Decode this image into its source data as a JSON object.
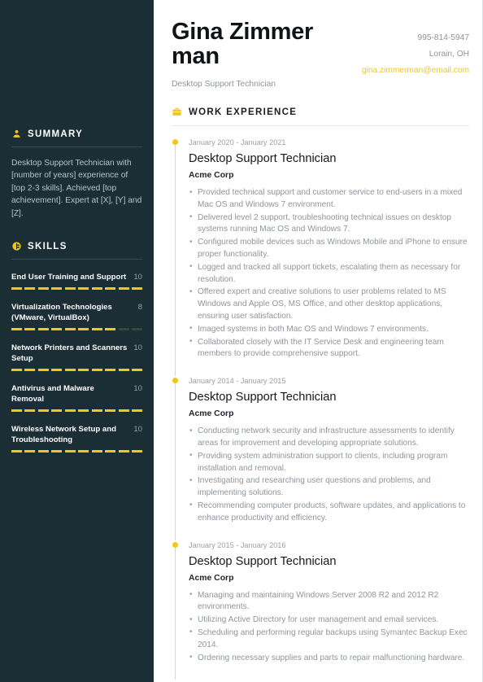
{
  "theme": {
    "sidebar_bg": "#1b2d35",
    "accent": "#f2c71b",
    "page_bg": "#ffffff",
    "muted_text": "#8e959a"
  },
  "sidebar": {
    "summary": {
      "icon": "person-icon",
      "heading": "SUMMARY",
      "text": "Desktop Support Technician with [number of years] experience of [top 2-3 skills]. Achieved [top achievement]. Expert at [X], [Y] and [Z]."
    },
    "skills": {
      "icon": "skill-badge-icon",
      "heading": "SKILLS",
      "max": 10,
      "items": [
        {
          "name": "End User Training and Support",
          "score": "10",
          "value": 10
        },
        {
          "name": "Virtualization Technologies (VMware, VirtualBox)",
          "score": "8",
          "value": 8
        },
        {
          "name": "Network Printers and Scanners Setup",
          "score": "10",
          "value": 10
        },
        {
          "name": "Antivirus and Malware Removal",
          "score": "10",
          "value": 10
        },
        {
          "name": "Wireless Network Setup and Troubleshooting",
          "score": "10",
          "value": 10
        }
      ]
    }
  },
  "header": {
    "name": "Gina Zimmerman",
    "title": "Desktop Support Technician",
    "contact": {
      "phone": "995-814-5947",
      "location": "Lorain, OH",
      "email": "gina.zimmerman@email.com"
    }
  },
  "work": {
    "icon": "briefcase-icon",
    "heading": "WORK EXPERIENCE",
    "jobs": [
      {
        "dates": "January 2020 - January 2021",
        "title": "Desktop Support Technician",
        "company": "Acme Corp",
        "bullets": [
          "Provided technical support and customer service to end-users in a mixed Mac OS and Windows 7 environment.",
          "Delivered level 2 support, troubleshooting technical issues on desktop systems running Mac OS and Windows 7.",
          "Configured mobile devices such as Windows Mobile and iPhone to ensure proper functionality.",
          "Logged and tracked all support tickets, escalating them as necessary for resolution.",
          "Offered expert and creative solutions to user problems related to MS Windows and Apple OS, MS Office, and other desktop applications, ensuring user satisfaction.",
          "Imaged systems in both Mac OS and Windows 7 environments.",
          "Collaborated closely with the IT Service Desk and engineering team members to provide comprehensive support."
        ]
      },
      {
        "dates": "January 2014 - January 2015",
        "title": "Desktop Support Technician",
        "company": "Acme Corp",
        "bullets": [
          "Conducting network security and infrastructure assessments to identify areas for improvement and developing appropriate solutions.",
          "Providing system administration support to clients, including program installation and removal.",
          "Investigating and researching user questions and problems, and implementing solutions.",
          "Recommending computer products, software updates, and applications to enhance productivity and efficiency."
        ]
      },
      {
        "dates": "January 2015 - January 2016",
        "title": "Desktop Support Technician",
        "company": "Acme Corp",
        "bullets": [
          "Managing and maintaining Windows Server 2008 R2 and 2012 R2 environments.",
          "Utilizing Active Directory for user management and email services.",
          "Scheduling and performing regular backups using Symantec Backup Exec 2014.",
          "Ordering necessary supplies and parts to repair malfunctioning hardware."
        ]
      }
    ]
  }
}
